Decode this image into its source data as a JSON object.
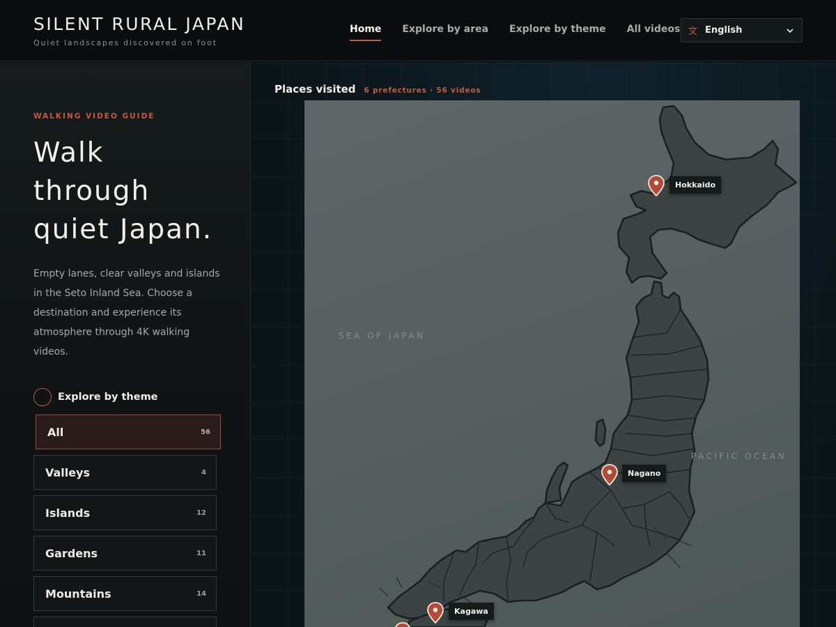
{
  "header": {
    "title": "SILENT RURAL JAPAN",
    "subtitle": "Quiet landscapes discovered on foot",
    "nav": [
      "Home",
      "Explore by area",
      "Explore by theme",
      "All videos"
    ],
    "language": {
      "icon": "文",
      "label": "English"
    }
  },
  "sidebar": {
    "eyebrow": "WALKING VIDEO GUIDE",
    "hero": [
      "Walk",
      "through",
      "quiet Japan."
    ],
    "description": "Empty lanes, clear valleys and islands in the Seto Inland Sea. Choose a destination and experience its atmosphere through 4K walking videos.",
    "theme_heading": "Explore by theme",
    "themes": [
      {
        "name": "All",
        "count": "56",
        "active": true
      },
      {
        "name": "Valleys",
        "count": "4"
      },
      {
        "name": "Islands",
        "count": "12"
      },
      {
        "name": "Gardens",
        "count": "11"
      },
      {
        "name": "Mountains",
        "count": "14"
      }
    ]
  },
  "map": {
    "title": "Places visited",
    "meta": "6 prefectures · 56 videos",
    "sea_left": "SEA OF JAPAN",
    "sea_right": "PACIFIC OCEAN",
    "pins": [
      "Hokkaido",
      "Nagano",
      "Kagawa"
    ]
  },
  "colors": {
    "accent": "#c65a3e",
    "land": "#3b4442",
    "sea": "#5b6263"
  }
}
